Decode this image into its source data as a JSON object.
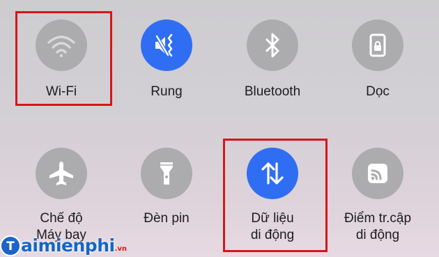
{
  "tiles": [
    {
      "label": "Wi-Fi",
      "icon": "wifi-icon",
      "state": "off",
      "highlighted": true
    },
    {
      "label": "Rung",
      "icon": "vibrate-icon",
      "state": "on",
      "highlighted": false
    },
    {
      "label": "Bluetooth",
      "icon": "bluetooth-icon",
      "state": "off",
      "highlighted": false
    },
    {
      "label": "Dọc",
      "icon": "rotation-lock-icon",
      "state": "off",
      "highlighted": false
    },
    {
      "label_line1": "Chế độ",
      "label_line2": "Máy bay",
      "icon": "airplane-icon",
      "state": "off",
      "highlighted": false
    },
    {
      "label": "Đèn pin",
      "icon": "flashlight-icon",
      "state": "off",
      "highlighted": false
    },
    {
      "label_line1": "Dữ liệu",
      "label_line2": "di động",
      "icon": "mobile-data-icon",
      "state": "on",
      "highlighted": true
    },
    {
      "label_line1": "Điểm tr.cập",
      "label_line2": "di động",
      "icon": "hotspot-icon",
      "state": "off",
      "highlighted": false
    }
  ],
  "colors": {
    "active": "#2f6ef3",
    "inactive": "#acabad",
    "highlight": "#d5161b"
  },
  "watermark": {
    "text": "aimienphi",
    "suffix": ".vn",
    "logo_letter": "T"
  }
}
